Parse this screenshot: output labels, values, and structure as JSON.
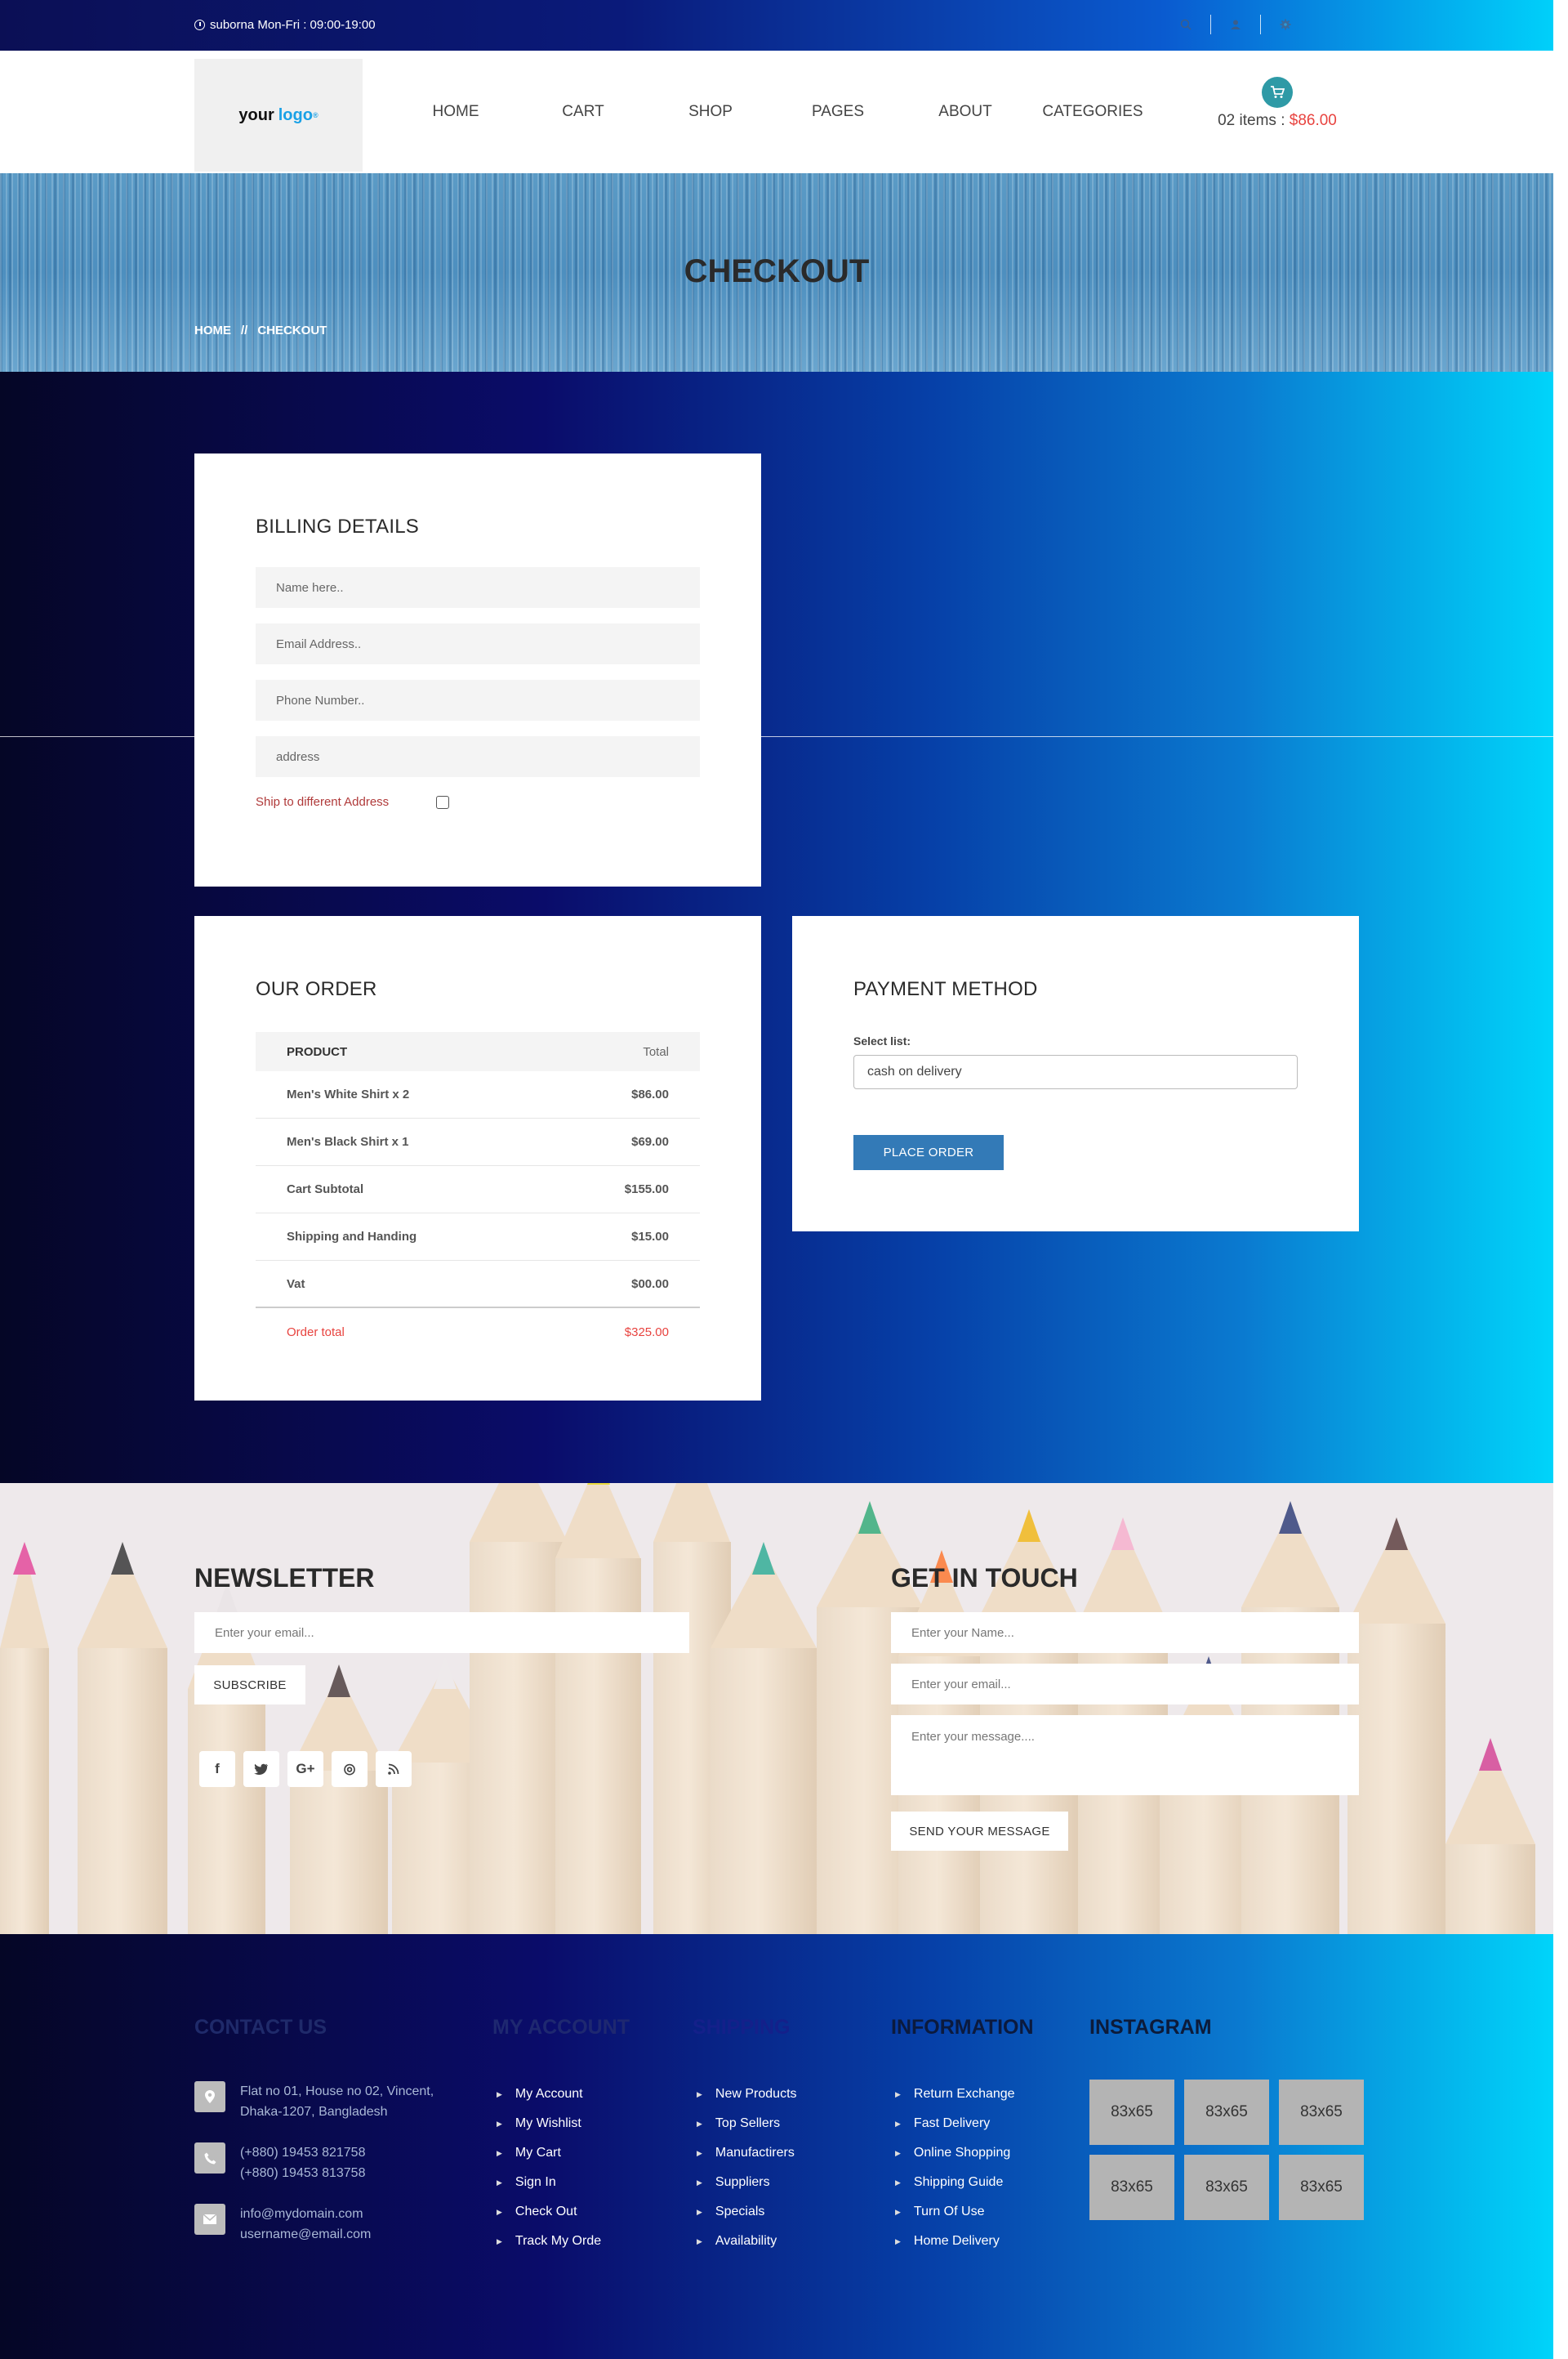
{
  "topbar": {
    "hours": "suborna Mon-Fri : 09:00-19:00",
    "icons": [
      "search-icon",
      "user-icon",
      "settings-icon"
    ]
  },
  "header": {
    "logo": {
      "part1": "your",
      "part2": "logo",
      "mark": "®"
    },
    "nav": [
      "HOME",
      "CART",
      "SHOP",
      "PAGES",
      "ABOUT",
      "CATEGORIES"
    ],
    "cart": {
      "items": "02 items :",
      "price": "$86.00"
    }
  },
  "banner": {
    "title": "CHECKOUT",
    "crumb_home": "HOME",
    "crumb_sep": "//",
    "crumb_current": "CHECKOUT"
  },
  "billing": {
    "title": "BILLING DETAILS",
    "name_placeholder": "Name here..",
    "email_placeholder": "Email Address..",
    "phone_placeholder": "Phone Number..",
    "address_placeholder": "address",
    "ship_label": "Ship to different Address"
  },
  "order": {
    "title": "OUR ORDER",
    "head_product": "PRODUCT",
    "head_total": "Total",
    "rows": [
      {
        "label": "Men's White Shirt x 2",
        "value": "$86.00"
      },
      {
        "label": "Men's Black Shirt x 1",
        "value": "$69.00"
      },
      {
        "label": "Cart Subtotal",
        "value": "$155.00"
      },
      {
        "label": "Shipping and Handing",
        "value": "$15.00"
      },
      {
        "label": "Vat",
        "value": "$00.00"
      }
    ],
    "total_label": "Order total",
    "total_value": "$325.00"
  },
  "payment": {
    "title": "PAYMENT METHOD",
    "select_label": "Select list:",
    "selected": "cash on delivery",
    "button": "PLACE ORDER"
  },
  "newsletter": {
    "title": "NEWSLETTER",
    "placeholder": "Enter your email...",
    "button": "SUBSCRIBE",
    "socials": [
      "f",
      "t",
      "G+",
      "◎",
      "rss"
    ]
  },
  "contact_form": {
    "title": "GET IN TOUCH",
    "name_placeholder": "Enter your Name...",
    "email_placeholder": "Enter your email...",
    "message_placeholder": "Enter your message....",
    "button": "SEND YOUR MESSAGE"
  },
  "footer": {
    "contact": {
      "title": "CONTACT US",
      "address1": "Flat no 01, House no 02, Vincent,",
      "address2": "Dhaka-1207, Bangladesh",
      "phone1": "(+880) 19453 821758",
      "phone2": "(+880) 19453 813758",
      "email1": "info@mydomain.com",
      "email2": "username@email.com"
    },
    "account": {
      "title": "MY ACCOUNT",
      "items": [
        "My Account",
        "My Wishlist",
        "My Cart",
        "Sign In",
        "Check Out",
        "Track My Orde"
      ]
    },
    "shipping": {
      "title": "SHIPPING",
      "items": [
        "New Products",
        "Top Sellers",
        "Manufactirers",
        "Suppliers",
        "Specials",
        "Availability"
      ]
    },
    "information": {
      "title": "INFORMATION",
      "items": [
        "Return Exchange",
        "Fast Delivery",
        "Online Shopping",
        "Shipping Guide",
        "Turn Of Use",
        "Home Delivery"
      ]
    },
    "instagram": {
      "title": "INSTAGRAM",
      "tiles": [
        "83x65",
        "83x65",
        "83x65",
        "83x65",
        "83x65",
        "83x65"
      ]
    }
  },
  "colors": {
    "accent_red": "#e8433f",
    "button_blue": "#337ab7",
    "cart_teal": "#2e9aa6"
  }
}
